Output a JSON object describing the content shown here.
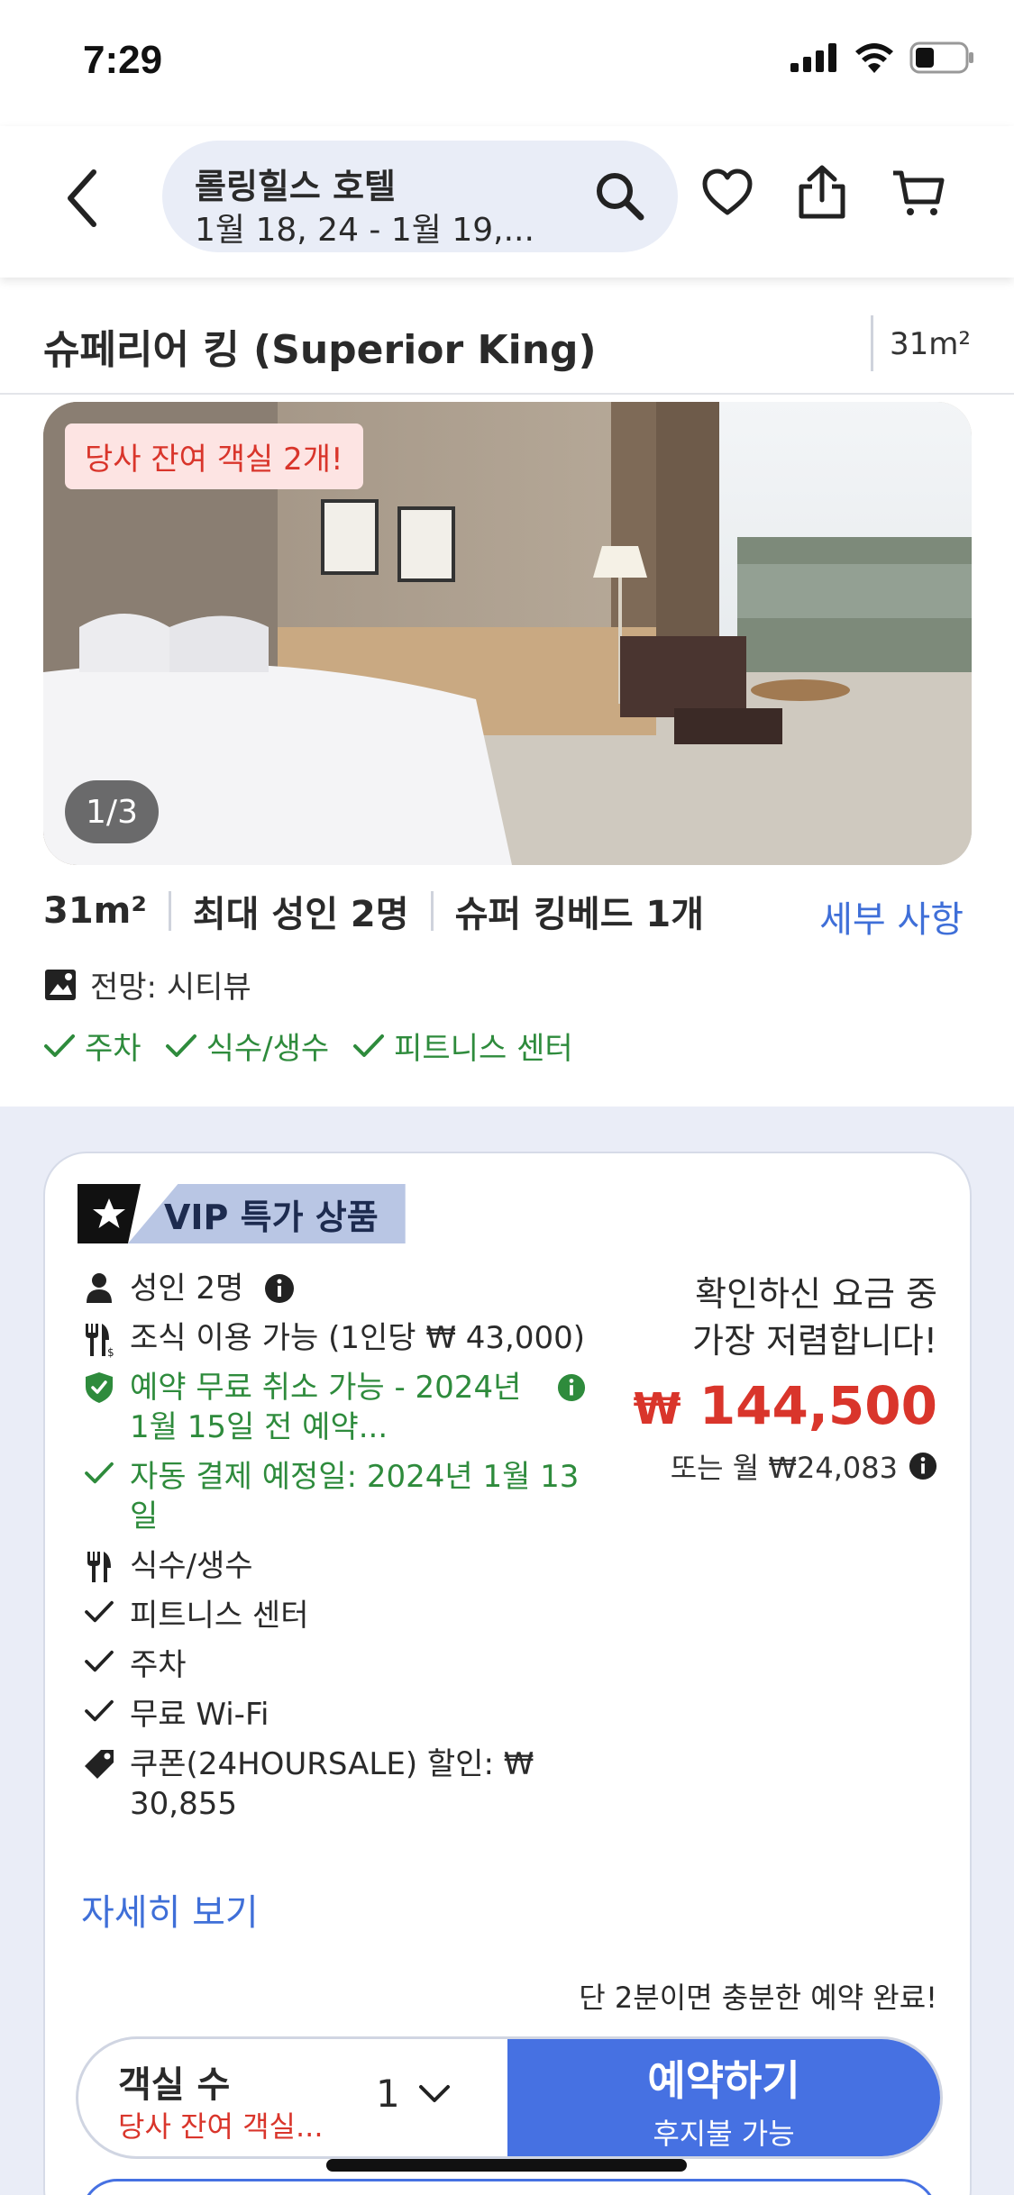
{
  "status_bar": {
    "time": "7:29"
  },
  "header": {
    "search_title": "롤링힐스 호텔",
    "search_dates": "1월 18, 24 - 1월 19,..."
  },
  "room": {
    "name": "슈페리어 킹 (Superior King)",
    "area": "31m²",
    "photo_badge": "당사 잔여 객실 2개!",
    "photo_counter": "1/3",
    "facts": [
      "31m²",
      "최대 성인 2명",
      "슈퍼 킹베드 1개"
    ],
    "details_link": "세부 사항",
    "view": "전망: 시티뷰",
    "amenities": [
      "주차",
      "식수/생수",
      "피트니스 센터"
    ]
  },
  "offer": {
    "tag": "VIP 특가 상품",
    "guests": "성인 2명",
    "breakfast": "조식 이용 가능 (1인당 ₩ 43,000)",
    "free_cancel": "예약 무료 취소 가능 - 2024년 1월 15일 전 예약...",
    "auto_pay": "자동 결제 예정일: 2024년 1월 13일",
    "water": "식수/생수",
    "fitness": "피트니스 센터",
    "parking": "주차",
    "wifi": "무료 Wi-Fi",
    "coupon": "쿠폰(24HOURSALE) 할인: ₩ 30,855",
    "more_link": "자세히 보기",
    "cheapest_line1": "확인하신 요금 중",
    "cheapest_line2": "가장 저렴합니다!",
    "price_currency": "₩",
    "price": "144,500",
    "monthly": "또는 월 ₩24,083",
    "quick_note": "단 2분이면 충분한 예약 완료!",
    "rooms_label": "객실 수",
    "rooms_warning": "당사 잔여 객실...",
    "rooms_qty": "1",
    "book_label": "예약하기",
    "book_sub": "후지불 가능"
  },
  "colors": {
    "accent": "#4671e2",
    "price": "#d9352b",
    "success": "#2e8b3c"
  }
}
